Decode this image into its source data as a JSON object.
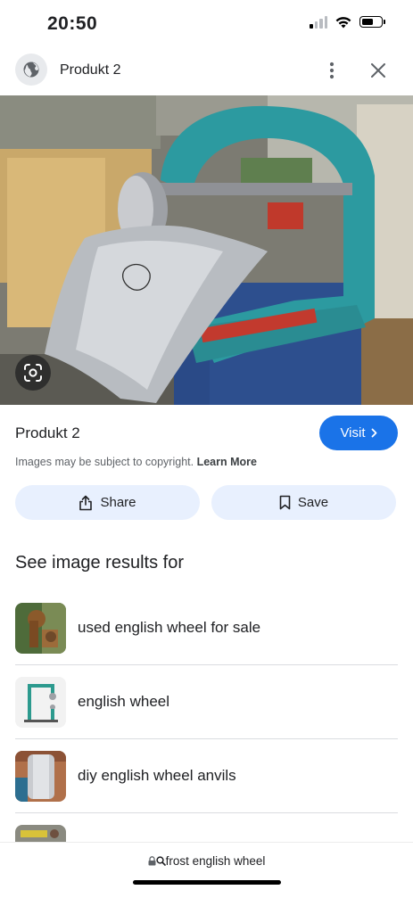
{
  "status_bar": {
    "time": "20:50"
  },
  "header": {
    "title": "Produkt 2"
  },
  "product": {
    "title": "Produkt 2",
    "visit_label": "Visit",
    "copyright_text": "Images may be subject to copyright.",
    "learn_more": "Learn More"
  },
  "actions": {
    "share_label": "Share",
    "save_label": "Save"
  },
  "related": {
    "heading": "See image results for",
    "items": [
      {
        "label": "used english wheel for sale"
      },
      {
        "label": "english wheel"
      },
      {
        "label": "diy english wheel anvils"
      }
    ]
  },
  "address_bar": {
    "url": "frost english wheel"
  },
  "colors": {
    "accent": "#1a73e8",
    "pill_bg": "#e8f0fe",
    "machine_teal": "#2c9aa0"
  }
}
